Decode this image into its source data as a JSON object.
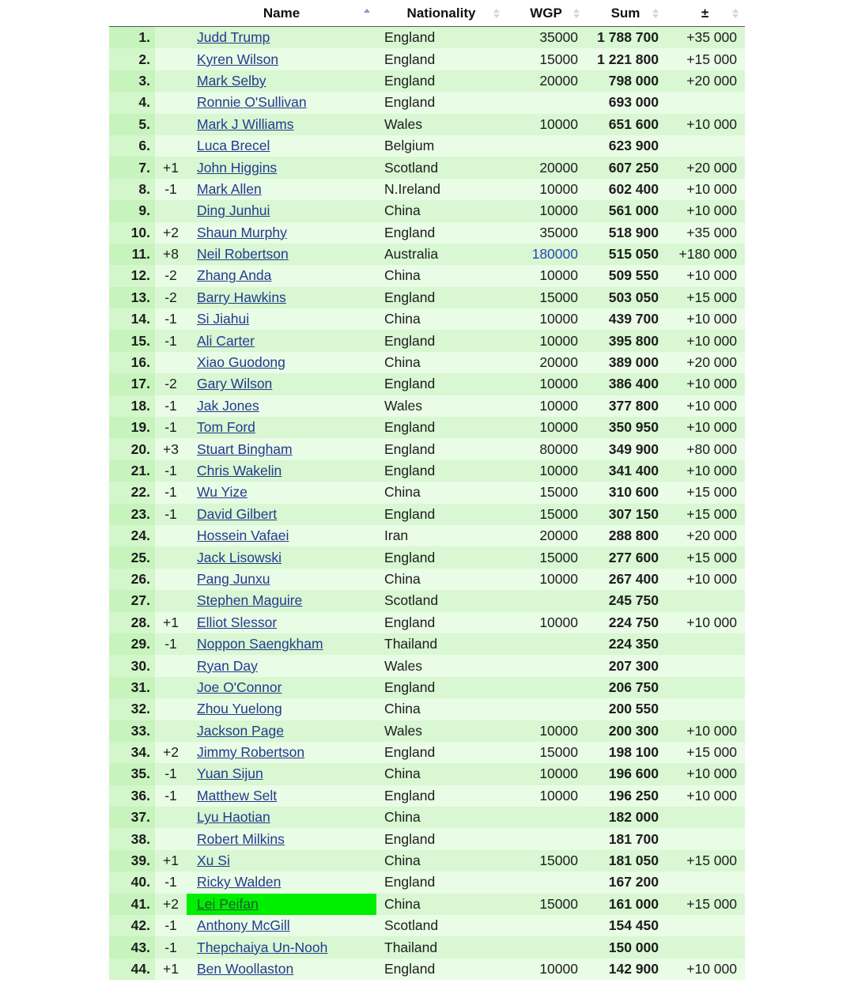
{
  "table": {
    "headers": {
      "rank": "",
      "move": "",
      "name": "Name",
      "nationality": "Nationality",
      "wgp": "WGP",
      "sum": "Sum",
      "diff": "±"
    },
    "sort": {
      "column": "name",
      "direction": "ascending"
    },
    "highlight_color": "#00ee00",
    "rows": [
      {
        "rank": "1.",
        "move": "",
        "name": "Judd Trump",
        "nationality": "England",
        "wgp": "35000",
        "sum": "1 788 700",
        "diff": "+35 000"
      },
      {
        "rank": "2.",
        "move": "",
        "name": "Kyren Wilson",
        "nationality": "England",
        "wgp": "15000",
        "sum": "1 221 800",
        "diff": "+15 000"
      },
      {
        "rank": "3.",
        "move": "",
        "name": "Mark Selby",
        "nationality": "England",
        "wgp": "20000",
        "sum": "798 000",
        "diff": "+20 000"
      },
      {
        "rank": "4.",
        "move": "",
        "name": "Ronnie O'Sullivan",
        "nationality": "England",
        "wgp": "",
        "sum": "693 000",
        "diff": ""
      },
      {
        "rank": "5.",
        "move": "",
        "name": "Mark J Williams",
        "nationality": "Wales",
        "wgp": "10000",
        "sum": "651 600",
        "diff": "+10 000"
      },
      {
        "rank": "6.",
        "move": "",
        "name": "Luca Brecel",
        "nationality": "Belgium",
        "wgp": "",
        "sum": "623 900",
        "diff": ""
      },
      {
        "rank": "7.",
        "move": "+1",
        "name": "John Higgins",
        "nationality": "Scotland",
        "wgp": "20000",
        "sum": "607 250",
        "diff": "+20 000"
      },
      {
        "rank": "8.",
        "move": "-1",
        "name": "Mark Allen",
        "nationality": "N.Ireland",
        "wgp": "10000",
        "sum": "602 400",
        "diff": "+10 000"
      },
      {
        "rank": "9.",
        "move": "",
        "name": "Ding Junhui",
        "nationality": "China",
        "wgp": "10000",
        "sum": "561 000",
        "diff": "+10 000"
      },
      {
        "rank": "10.",
        "move": "+2",
        "name": "Shaun Murphy",
        "nationality": "England",
        "wgp": "35000",
        "sum": "518 900",
        "diff": "+35 000"
      },
      {
        "rank": "11.",
        "move": "+8",
        "name": "Neil Robertson",
        "nationality": "Australia",
        "wgp": "180000",
        "wgp_link": true,
        "sum": "515 050",
        "diff": "+180 000"
      },
      {
        "rank": "12.",
        "move": "-2",
        "name": "Zhang Anda",
        "nationality": "China",
        "wgp": "10000",
        "sum": "509 550",
        "diff": "+10 000"
      },
      {
        "rank": "13.",
        "move": "-2",
        "name": "Barry Hawkins",
        "nationality": "England",
        "wgp": "15000",
        "sum": "503 050",
        "diff": "+15 000"
      },
      {
        "rank": "14.",
        "move": "-1",
        "name": "Si Jiahui",
        "nationality": "China",
        "wgp": "10000",
        "sum": "439 700",
        "diff": "+10 000"
      },
      {
        "rank": "15.",
        "move": "-1",
        "name": "Ali Carter",
        "nationality": "England",
        "wgp": "10000",
        "sum": "395 800",
        "diff": "+10 000"
      },
      {
        "rank": "16.",
        "move": "",
        "name": "Xiao Guodong",
        "nationality": "China",
        "wgp": "20000",
        "sum": "389 000",
        "diff": "+20 000"
      },
      {
        "rank": "17.",
        "move": "-2",
        "name": "Gary Wilson",
        "nationality": "England",
        "wgp": "10000",
        "sum": "386 400",
        "diff": "+10 000"
      },
      {
        "rank": "18.",
        "move": "-1",
        "name": "Jak Jones",
        "nationality": "Wales",
        "wgp": "10000",
        "sum": "377 800",
        "diff": "+10 000"
      },
      {
        "rank": "19.",
        "move": "-1",
        "name": "Tom Ford",
        "nationality": "England",
        "wgp": "10000",
        "sum": "350 950",
        "diff": "+10 000"
      },
      {
        "rank": "20.",
        "move": "+3",
        "name": "Stuart Bingham",
        "nationality": "England",
        "wgp": "80000",
        "sum": "349 900",
        "diff": "+80 000"
      },
      {
        "rank": "21.",
        "move": "-1",
        "name": "Chris Wakelin",
        "nationality": "England",
        "wgp": "10000",
        "sum": "341 400",
        "diff": "+10 000"
      },
      {
        "rank": "22.",
        "move": "-1",
        "name": "Wu Yize",
        "nationality": "China",
        "wgp": "15000",
        "sum": "310 600",
        "diff": "+15 000"
      },
      {
        "rank": "23.",
        "move": "-1",
        "name": "David Gilbert",
        "nationality": "England",
        "wgp": "15000",
        "sum": "307 150",
        "diff": "+15 000"
      },
      {
        "rank": "24.",
        "move": "",
        "name": "Hossein Vafaei",
        "nationality": "Iran",
        "wgp": "20000",
        "sum": "288 800",
        "diff": "+20 000"
      },
      {
        "rank": "25.",
        "move": "",
        "name": "Jack Lisowski",
        "nationality": "England",
        "wgp": "15000",
        "sum": "277 600",
        "diff": "+15 000"
      },
      {
        "rank": "26.",
        "move": "",
        "name": "Pang Junxu",
        "nationality": "China",
        "wgp": "10000",
        "sum": "267 400",
        "diff": "+10 000"
      },
      {
        "rank": "27.",
        "move": "",
        "name": "Stephen Maguire",
        "nationality": "Scotland",
        "wgp": "",
        "sum": "245 750",
        "diff": ""
      },
      {
        "rank": "28.",
        "move": "+1",
        "name": "Elliot Slessor",
        "nationality": "England",
        "wgp": "10000",
        "sum": "224 750",
        "diff": "+10 000"
      },
      {
        "rank": "29.",
        "move": "-1",
        "name": "Noppon Saengkham",
        "nationality": "Thailand",
        "wgp": "",
        "sum": "224 350",
        "diff": ""
      },
      {
        "rank": "30.",
        "move": "",
        "name": "Ryan Day",
        "nationality": "Wales",
        "wgp": "",
        "sum": "207 300",
        "diff": ""
      },
      {
        "rank": "31.",
        "move": "",
        "name": "Joe O'Connor",
        "nationality": "England",
        "wgp": "",
        "sum": "206 750",
        "diff": ""
      },
      {
        "rank": "32.",
        "move": "",
        "name": "Zhou Yuelong",
        "nationality": "China",
        "wgp": "",
        "sum": "200 550",
        "diff": ""
      },
      {
        "rank": "33.",
        "move": "",
        "name": "Jackson Page",
        "nationality": "Wales",
        "wgp": "10000",
        "sum": "200 300",
        "diff": "+10 000"
      },
      {
        "rank": "34.",
        "move": "+2",
        "name": "Jimmy Robertson",
        "nationality": "England",
        "wgp": "15000",
        "sum": "198 100",
        "diff": "+15 000"
      },
      {
        "rank": "35.",
        "move": "-1",
        "name": "Yuan Sijun",
        "nationality": "China",
        "wgp": "10000",
        "sum": "196 600",
        "diff": "+10 000"
      },
      {
        "rank": "36.",
        "move": "-1",
        "name": "Matthew Selt",
        "nationality": "England",
        "wgp": "10000",
        "sum": "196 250",
        "diff": "+10 000"
      },
      {
        "rank": "37.",
        "move": "",
        "name": "Lyu Haotian",
        "nationality": "China",
        "wgp": "",
        "sum": "182 000",
        "diff": ""
      },
      {
        "rank": "38.",
        "move": "",
        "name": "Robert Milkins",
        "nationality": "England",
        "wgp": "",
        "sum": "181 700",
        "diff": ""
      },
      {
        "rank": "39.",
        "move": "+1",
        "name": "Xu Si",
        "nationality": "China",
        "wgp": "15000",
        "sum": "181 050",
        "diff": "+15 000"
      },
      {
        "rank": "40.",
        "move": "-1",
        "name": "Ricky Walden",
        "nationality": "England",
        "wgp": "",
        "sum": "167 200",
        "diff": ""
      },
      {
        "rank": "41.",
        "move": "+2",
        "name": "Lei Peifan",
        "highlighted": true,
        "nationality": "China",
        "wgp": "15000",
        "sum": "161 000",
        "diff": "+15 000"
      },
      {
        "rank": "42.",
        "move": "-1",
        "name": "Anthony McGill",
        "nationality": "Scotland",
        "wgp": "",
        "sum": "154 450",
        "diff": ""
      },
      {
        "rank": "43.",
        "move": "-1",
        "name": "Thepchaiya Un-Nooh",
        "nationality": "Thailand",
        "wgp": "",
        "sum": "150 000",
        "diff": ""
      },
      {
        "rank": "44.",
        "move": "+1",
        "name": "Ben Woollaston",
        "nationality": "England",
        "wgp": "10000",
        "sum": "142 900",
        "diff": "+10 000"
      }
    ]
  }
}
